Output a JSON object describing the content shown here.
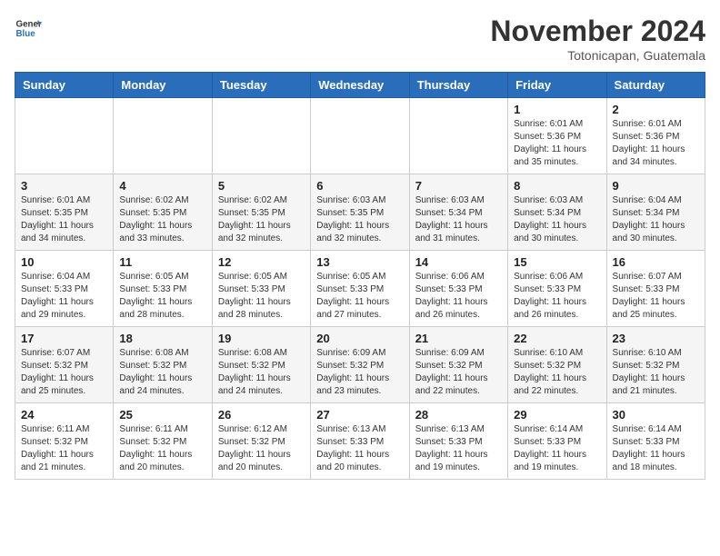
{
  "header": {
    "logo_line1": "General",
    "logo_line2": "Blue",
    "month_title": "November 2024",
    "location": "Totonicapan, Guatemala"
  },
  "weekdays": [
    "Sunday",
    "Monday",
    "Tuesday",
    "Wednesday",
    "Thursday",
    "Friday",
    "Saturday"
  ],
  "weeks": [
    [
      {
        "day": "",
        "info": ""
      },
      {
        "day": "",
        "info": ""
      },
      {
        "day": "",
        "info": ""
      },
      {
        "day": "",
        "info": ""
      },
      {
        "day": "",
        "info": ""
      },
      {
        "day": "1",
        "info": "Sunrise: 6:01 AM\nSunset: 5:36 PM\nDaylight: 11 hours\nand 35 minutes."
      },
      {
        "day": "2",
        "info": "Sunrise: 6:01 AM\nSunset: 5:36 PM\nDaylight: 11 hours\nand 34 minutes."
      }
    ],
    [
      {
        "day": "3",
        "info": "Sunrise: 6:01 AM\nSunset: 5:35 PM\nDaylight: 11 hours\nand 34 minutes."
      },
      {
        "day": "4",
        "info": "Sunrise: 6:02 AM\nSunset: 5:35 PM\nDaylight: 11 hours\nand 33 minutes."
      },
      {
        "day": "5",
        "info": "Sunrise: 6:02 AM\nSunset: 5:35 PM\nDaylight: 11 hours\nand 32 minutes."
      },
      {
        "day": "6",
        "info": "Sunrise: 6:03 AM\nSunset: 5:35 PM\nDaylight: 11 hours\nand 32 minutes."
      },
      {
        "day": "7",
        "info": "Sunrise: 6:03 AM\nSunset: 5:34 PM\nDaylight: 11 hours\nand 31 minutes."
      },
      {
        "day": "8",
        "info": "Sunrise: 6:03 AM\nSunset: 5:34 PM\nDaylight: 11 hours\nand 30 minutes."
      },
      {
        "day": "9",
        "info": "Sunrise: 6:04 AM\nSunset: 5:34 PM\nDaylight: 11 hours\nand 30 minutes."
      }
    ],
    [
      {
        "day": "10",
        "info": "Sunrise: 6:04 AM\nSunset: 5:33 PM\nDaylight: 11 hours\nand 29 minutes."
      },
      {
        "day": "11",
        "info": "Sunrise: 6:05 AM\nSunset: 5:33 PM\nDaylight: 11 hours\nand 28 minutes."
      },
      {
        "day": "12",
        "info": "Sunrise: 6:05 AM\nSunset: 5:33 PM\nDaylight: 11 hours\nand 28 minutes."
      },
      {
        "day": "13",
        "info": "Sunrise: 6:05 AM\nSunset: 5:33 PM\nDaylight: 11 hours\nand 27 minutes."
      },
      {
        "day": "14",
        "info": "Sunrise: 6:06 AM\nSunset: 5:33 PM\nDaylight: 11 hours\nand 26 minutes."
      },
      {
        "day": "15",
        "info": "Sunrise: 6:06 AM\nSunset: 5:33 PM\nDaylight: 11 hours\nand 26 minutes."
      },
      {
        "day": "16",
        "info": "Sunrise: 6:07 AM\nSunset: 5:33 PM\nDaylight: 11 hours\nand 25 minutes."
      }
    ],
    [
      {
        "day": "17",
        "info": "Sunrise: 6:07 AM\nSunset: 5:32 PM\nDaylight: 11 hours\nand 25 minutes."
      },
      {
        "day": "18",
        "info": "Sunrise: 6:08 AM\nSunset: 5:32 PM\nDaylight: 11 hours\nand 24 minutes."
      },
      {
        "day": "19",
        "info": "Sunrise: 6:08 AM\nSunset: 5:32 PM\nDaylight: 11 hours\nand 24 minutes."
      },
      {
        "day": "20",
        "info": "Sunrise: 6:09 AM\nSunset: 5:32 PM\nDaylight: 11 hours\nand 23 minutes."
      },
      {
        "day": "21",
        "info": "Sunrise: 6:09 AM\nSunset: 5:32 PM\nDaylight: 11 hours\nand 22 minutes."
      },
      {
        "day": "22",
        "info": "Sunrise: 6:10 AM\nSunset: 5:32 PM\nDaylight: 11 hours\nand 22 minutes."
      },
      {
        "day": "23",
        "info": "Sunrise: 6:10 AM\nSunset: 5:32 PM\nDaylight: 11 hours\nand 21 minutes."
      }
    ],
    [
      {
        "day": "24",
        "info": "Sunrise: 6:11 AM\nSunset: 5:32 PM\nDaylight: 11 hours\nand 21 minutes."
      },
      {
        "day": "25",
        "info": "Sunrise: 6:11 AM\nSunset: 5:32 PM\nDaylight: 11 hours\nand 20 minutes."
      },
      {
        "day": "26",
        "info": "Sunrise: 6:12 AM\nSunset: 5:32 PM\nDaylight: 11 hours\nand 20 minutes."
      },
      {
        "day": "27",
        "info": "Sunrise: 6:13 AM\nSunset: 5:33 PM\nDaylight: 11 hours\nand 20 minutes."
      },
      {
        "day": "28",
        "info": "Sunrise: 6:13 AM\nSunset: 5:33 PM\nDaylight: 11 hours\nand 19 minutes."
      },
      {
        "day": "29",
        "info": "Sunrise: 6:14 AM\nSunset: 5:33 PM\nDaylight: 11 hours\nand 19 minutes."
      },
      {
        "day": "30",
        "info": "Sunrise: 6:14 AM\nSunset: 5:33 PM\nDaylight: 11 hours\nand 18 minutes."
      }
    ]
  ]
}
